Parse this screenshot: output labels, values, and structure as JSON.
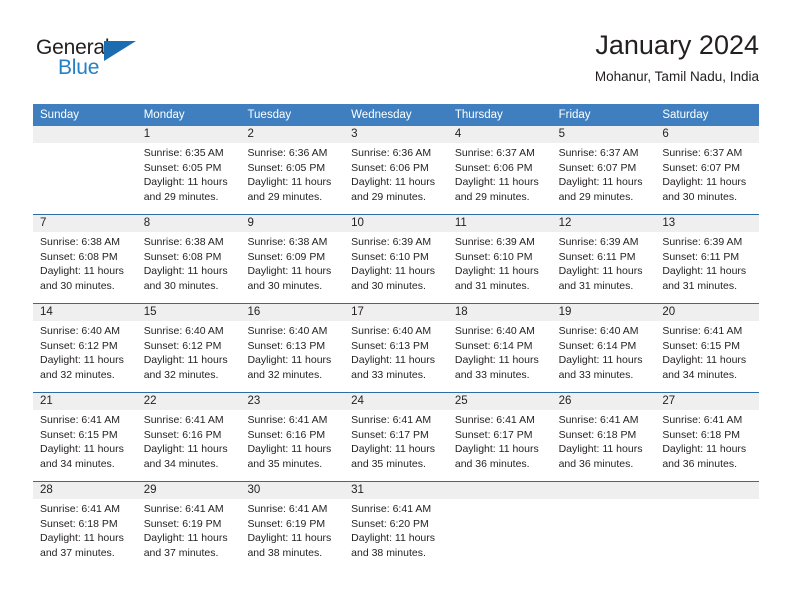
{
  "brand": {
    "name_part1": "General",
    "name_part2": "Blue",
    "triangle_color": "#1b6cb0",
    "blue_color": "#2481c6"
  },
  "header": {
    "title": "January 2024",
    "subtitle": "Mohanur, Tamil Nadu, India"
  },
  "theme": {
    "header_row_bg": "#3f7fbf",
    "day_band_bg": "#efefef",
    "week_separator": "#2e6da4",
    "text": "#231f20"
  },
  "weekdays": [
    "Sunday",
    "Monday",
    "Tuesday",
    "Wednesday",
    "Thursday",
    "Friday",
    "Saturday"
  ],
  "weeks": [
    [
      {
        "day": "",
        "sunrise": "",
        "sunset": "",
        "daylight1": "",
        "daylight2": ""
      },
      {
        "day": "1",
        "sunrise": "Sunrise: 6:35 AM",
        "sunset": "Sunset: 6:05 PM",
        "daylight1": "Daylight: 11 hours",
        "daylight2": "and 29 minutes."
      },
      {
        "day": "2",
        "sunrise": "Sunrise: 6:36 AM",
        "sunset": "Sunset: 6:05 PM",
        "daylight1": "Daylight: 11 hours",
        "daylight2": "and 29 minutes."
      },
      {
        "day": "3",
        "sunrise": "Sunrise: 6:36 AM",
        "sunset": "Sunset: 6:06 PM",
        "daylight1": "Daylight: 11 hours",
        "daylight2": "and 29 minutes."
      },
      {
        "day": "4",
        "sunrise": "Sunrise: 6:37 AM",
        "sunset": "Sunset: 6:06 PM",
        "daylight1": "Daylight: 11 hours",
        "daylight2": "and 29 minutes."
      },
      {
        "day": "5",
        "sunrise": "Sunrise: 6:37 AM",
        "sunset": "Sunset: 6:07 PM",
        "daylight1": "Daylight: 11 hours",
        "daylight2": "and 29 minutes."
      },
      {
        "day": "6",
        "sunrise": "Sunrise: 6:37 AM",
        "sunset": "Sunset: 6:07 PM",
        "daylight1": "Daylight: 11 hours",
        "daylight2": "and 30 minutes."
      }
    ],
    [
      {
        "day": "7",
        "sunrise": "Sunrise: 6:38 AM",
        "sunset": "Sunset: 6:08 PM",
        "daylight1": "Daylight: 11 hours",
        "daylight2": "and 30 minutes."
      },
      {
        "day": "8",
        "sunrise": "Sunrise: 6:38 AM",
        "sunset": "Sunset: 6:08 PM",
        "daylight1": "Daylight: 11 hours",
        "daylight2": "and 30 minutes."
      },
      {
        "day": "9",
        "sunrise": "Sunrise: 6:38 AM",
        "sunset": "Sunset: 6:09 PM",
        "daylight1": "Daylight: 11 hours",
        "daylight2": "and 30 minutes."
      },
      {
        "day": "10",
        "sunrise": "Sunrise: 6:39 AM",
        "sunset": "Sunset: 6:10 PM",
        "daylight1": "Daylight: 11 hours",
        "daylight2": "and 30 minutes."
      },
      {
        "day": "11",
        "sunrise": "Sunrise: 6:39 AM",
        "sunset": "Sunset: 6:10 PM",
        "daylight1": "Daylight: 11 hours",
        "daylight2": "and 31 minutes."
      },
      {
        "day": "12",
        "sunrise": "Sunrise: 6:39 AM",
        "sunset": "Sunset: 6:11 PM",
        "daylight1": "Daylight: 11 hours",
        "daylight2": "and 31 minutes."
      },
      {
        "day": "13",
        "sunrise": "Sunrise: 6:39 AM",
        "sunset": "Sunset: 6:11 PM",
        "daylight1": "Daylight: 11 hours",
        "daylight2": "and 31 minutes."
      }
    ],
    [
      {
        "day": "14",
        "sunrise": "Sunrise: 6:40 AM",
        "sunset": "Sunset: 6:12 PM",
        "daylight1": "Daylight: 11 hours",
        "daylight2": "and 32 minutes."
      },
      {
        "day": "15",
        "sunrise": "Sunrise: 6:40 AM",
        "sunset": "Sunset: 6:12 PM",
        "daylight1": "Daylight: 11 hours",
        "daylight2": "and 32 minutes."
      },
      {
        "day": "16",
        "sunrise": "Sunrise: 6:40 AM",
        "sunset": "Sunset: 6:13 PM",
        "daylight1": "Daylight: 11 hours",
        "daylight2": "and 32 minutes."
      },
      {
        "day": "17",
        "sunrise": "Sunrise: 6:40 AM",
        "sunset": "Sunset: 6:13 PM",
        "daylight1": "Daylight: 11 hours",
        "daylight2": "and 33 minutes."
      },
      {
        "day": "18",
        "sunrise": "Sunrise: 6:40 AM",
        "sunset": "Sunset: 6:14 PM",
        "daylight1": "Daylight: 11 hours",
        "daylight2": "and 33 minutes."
      },
      {
        "day": "19",
        "sunrise": "Sunrise: 6:40 AM",
        "sunset": "Sunset: 6:14 PM",
        "daylight1": "Daylight: 11 hours",
        "daylight2": "and 33 minutes."
      },
      {
        "day": "20",
        "sunrise": "Sunrise: 6:41 AM",
        "sunset": "Sunset: 6:15 PM",
        "daylight1": "Daylight: 11 hours",
        "daylight2": "and 34 minutes."
      }
    ],
    [
      {
        "day": "21",
        "sunrise": "Sunrise: 6:41 AM",
        "sunset": "Sunset: 6:15 PM",
        "daylight1": "Daylight: 11 hours",
        "daylight2": "and 34 minutes."
      },
      {
        "day": "22",
        "sunrise": "Sunrise: 6:41 AM",
        "sunset": "Sunset: 6:16 PM",
        "daylight1": "Daylight: 11 hours",
        "daylight2": "and 34 minutes."
      },
      {
        "day": "23",
        "sunrise": "Sunrise: 6:41 AM",
        "sunset": "Sunset: 6:16 PM",
        "daylight1": "Daylight: 11 hours",
        "daylight2": "and 35 minutes."
      },
      {
        "day": "24",
        "sunrise": "Sunrise: 6:41 AM",
        "sunset": "Sunset: 6:17 PM",
        "daylight1": "Daylight: 11 hours",
        "daylight2": "and 35 minutes."
      },
      {
        "day": "25",
        "sunrise": "Sunrise: 6:41 AM",
        "sunset": "Sunset: 6:17 PM",
        "daylight1": "Daylight: 11 hours",
        "daylight2": "and 36 minutes."
      },
      {
        "day": "26",
        "sunrise": "Sunrise: 6:41 AM",
        "sunset": "Sunset: 6:18 PM",
        "daylight1": "Daylight: 11 hours",
        "daylight2": "and 36 minutes."
      },
      {
        "day": "27",
        "sunrise": "Sunrise: 6:41 AM",
        "sunset": "Sunset: 6:18 PM",
        "daylight1": "Daylight: 11 hours",
        "daylight2": "and 36 minutes."
      }
    ],
    [
      {
        "day": "28",
        "sunrise": "Sunrise: 6:41 AM",
        "sunset": "Sunset: 6:18 PM",
        "daylight1": "Daylight: 11 hours",
        "daylight2": "and 37 minutes."
      },
      {
        "day": "29",
        "sunrise": "Sunrise: 6:41 AM",
        "sunset": "Sunset: 6:19 PM",
        "daylight1": "Daylight: 11 hours",
        "daylight2": "and 37 minutes."
      },
      {
        "day": "30",
        "sunrise": "Sunrise: 6:41 AM",
        "sunset": "Sunset: 6:19 PM",
        "daylight1": "Daylight: 11 hours",
        "daylight2": "and 38 minutes."
      },
      {
        "day": "31",
        "sunrise": "Sunrise: 6:41 AM",
        "sunset": "Sunset: 6:20 PM",
        "daylight1": "Daylight: 11 hours",
        "daylight2": "and 38 minutes."
      },
      {
        "day": "",
        "sunrise": "",
        "sunset": "",
        "daylight1": "",
        "daylight2": ""
      },
      {
        "day": "",
        "sunrise": "",
        "sunset": "",
        "daylight1": "",
        "daylight2": ""
      },
      {
        "day": "",
        "sunrise": "",
        "sunset": "",
        "daylight1": "",
        "daylight2": ""
      }
    ]
  ]
}
